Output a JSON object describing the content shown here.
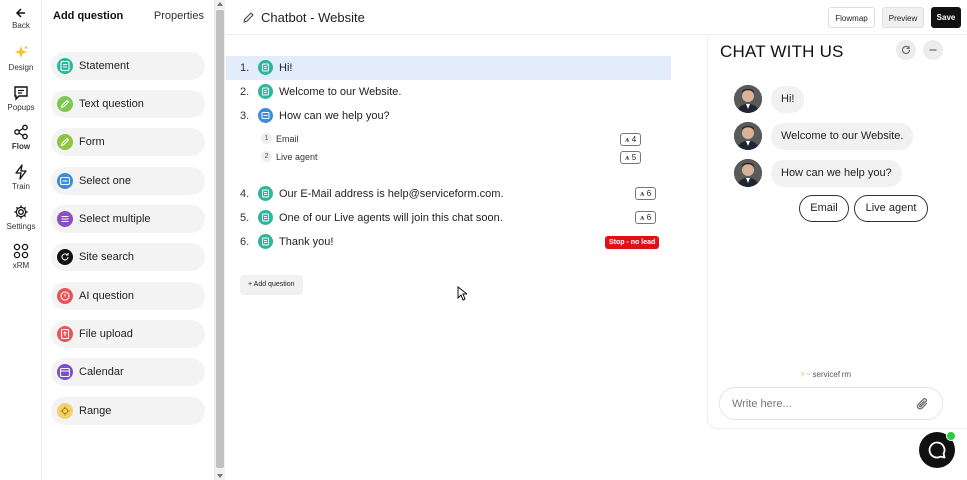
{
  "rail": {
    "back": "Back",
    "items": [
      {
        "label": "Design",
        "icon": "sparkle-icon"
      },
      {
        "label": "Popups",
        "icon": "chat-bubble-icon"
      },
      {
        "label": "Flow",
        "icon": "share-nodes-icon"
      },
      {
        "label": "Train",
        "icon": "bolt-icon"
      },
      {
        "label": "Settings",
        "icon": "gear-icon"
      },
      {
        "label": "xRM",
        "icon": "grid-icon"
      }
    ],
    "active": "Flow"
  },
  "panel": {
    "tab_add": "Add question",
    "tab_properties": "Properties",
    "types": [
      {
        "label": "Statement",
        "color": "#2bb79a"
      },
      {
        "label": "Text question",
        "color": "#7ec850"
      },
      {
        "label": "Form",
        "color": "#8fc43f"
      },
      {
        "label": "Select one",
        "color": "#3a8dd6"
      },
      {
        "label": "Select multiple",
        "color": "#8a4fc7"
      },
      {
        "label": "Site search",
        "color": "#111111"
      },
      {
        "label": "AI question",
        "color": "#e8545a"
      },
      {
        "label": "File upload",
        "color": "#e8545a"
      },
      {
        "label": "Calendar",
        "color": "#7b4fc9"
      },
      {
        "label": "Range",
        "color": "#f2d36b"
      }
    ]
  },
  "header": {
    "title": "Chatbot - Website",
    "flowmap": "Flowmap",
    "preview": "Preview",
    "save": "Save"
  },
  "flow": {
    "questions": [
      {
        "num": "1.",
        "text": "Hi!"
      },
      {
        "num": "2.",
        "text": "Welcome to our Website."
      },
      {
        "num": "3.",
        "text": "How can we help you?"
      },
      {
        "num": "4.",
        "text": "Our E-Mail address is help@serviceform.com.",
        "badge": "6"
      },
      {
        "num": "5.",
        "text": "One of our Live agents will join this chat soon.",
        "badge": "6"
      },
      {
        "num": "6.",
        "text": "Thank you!",
        "stop": "Stop - no lead"
      }
    ],
    "options": [
      {
        "num": "1",
        "text": "Email",
        "badge": "4"
      },
      {
        "num": "2",
        "text": "Live agent",
        "badge": "5"
      }
    ],
    "add_question": "+ Add question"
  },
  "chat": {
    "title": "CHAT WITH US",
    "messages": [
      "Hi!",
      "Welcome to our Website.",
      "How can we help you?"
    ],
    "options": [
      "Email",
      "Live agent"
    ],
    "brand": "servicef rm",
    "input_placeholder": "Write here..."
  }
}
